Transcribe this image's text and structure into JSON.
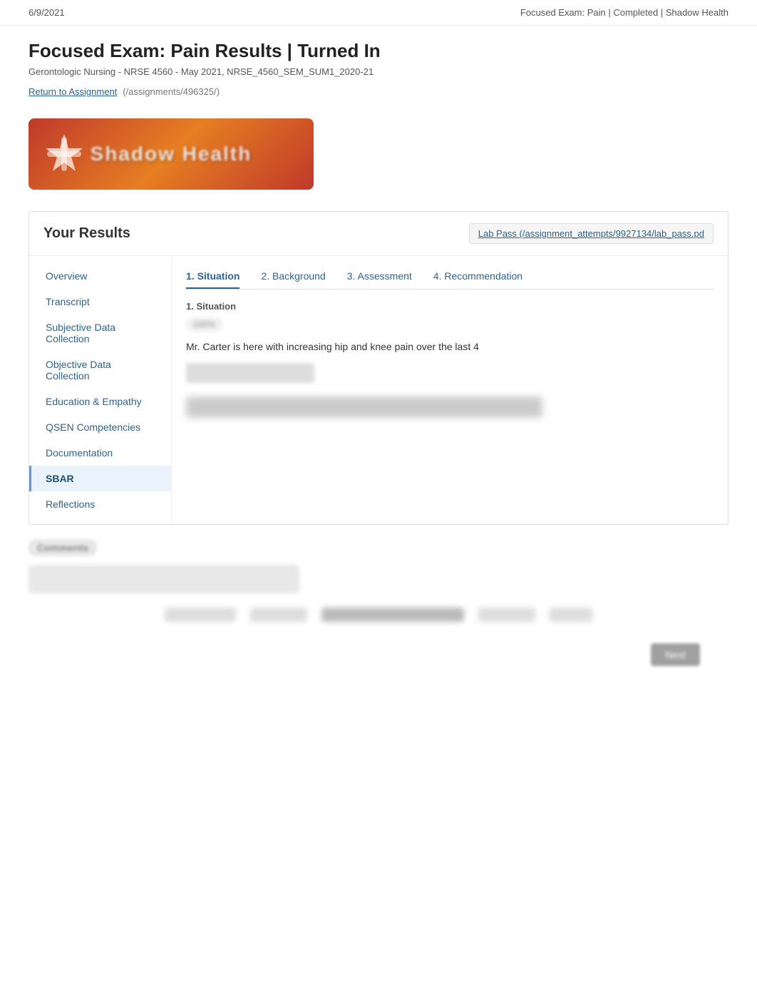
{
  "topbar": {
    "date": "6/9/2021",
    "title": "Focused Exam: Pain | Completed | Shadow Health"
  },
  "header": {
    "page_title": "Focused Exam: Pain Results | Turned In",
    "subtitle": "Gerontologic Nursing - NRSE 4560 - May 2021, NRSE_4560_SEM_SUM1_2020-21",
    "return_link_text": "Return to Assignment",
    "return_link_path": "(/assignments/496325/)"
  },
  "logo": {
    "text": "Shadow Health"
  },
  "results": {
    "title": "Your Results",
    "lab_pass_link": "Lab Pass (/assignment_attempts/9927134/lab_pass.pd"
  },
  "sidebar": {
    "items": [
      {
        "label": "Overview",
        "id": "overview"
      },
      {
        "label": "Transcript",
        "id": "transcript"
      },
      {
        "label": "Subjective Data Collection",
        "id": "subjective"
      },
      {
        "label": "Objective Data Collection",
        "id": "objective"
      },
      {
        "label": "Education & Empathy",
        "id": "education"
      },
      {
        "label": "QSEN Competencies",
        "id": "qsen"
      },
      {
        "label": "Documentation",
        "id": "documentation"
      },
      {
        "label": "SBAR",
        "id": "sbar",
        "active": true
      },
      {
        "label": "Reflections",
        "id": "reflections"
      }
    ]
  },
  "sbar": {
    "tabs": [
      {
        "label": "1. Situation",
        "active": true
      },
      {
        "label": "2. Background"
      },
      {
        "label": "3. Assessment"
      },
      {
        "label": "4. Recommendation"
      }
    ],
    "active_tab_label": "1. Situation",
    "situation_text": "Mr. Carter is here with increasing hip and knee pain over the last 4"
  }
}
